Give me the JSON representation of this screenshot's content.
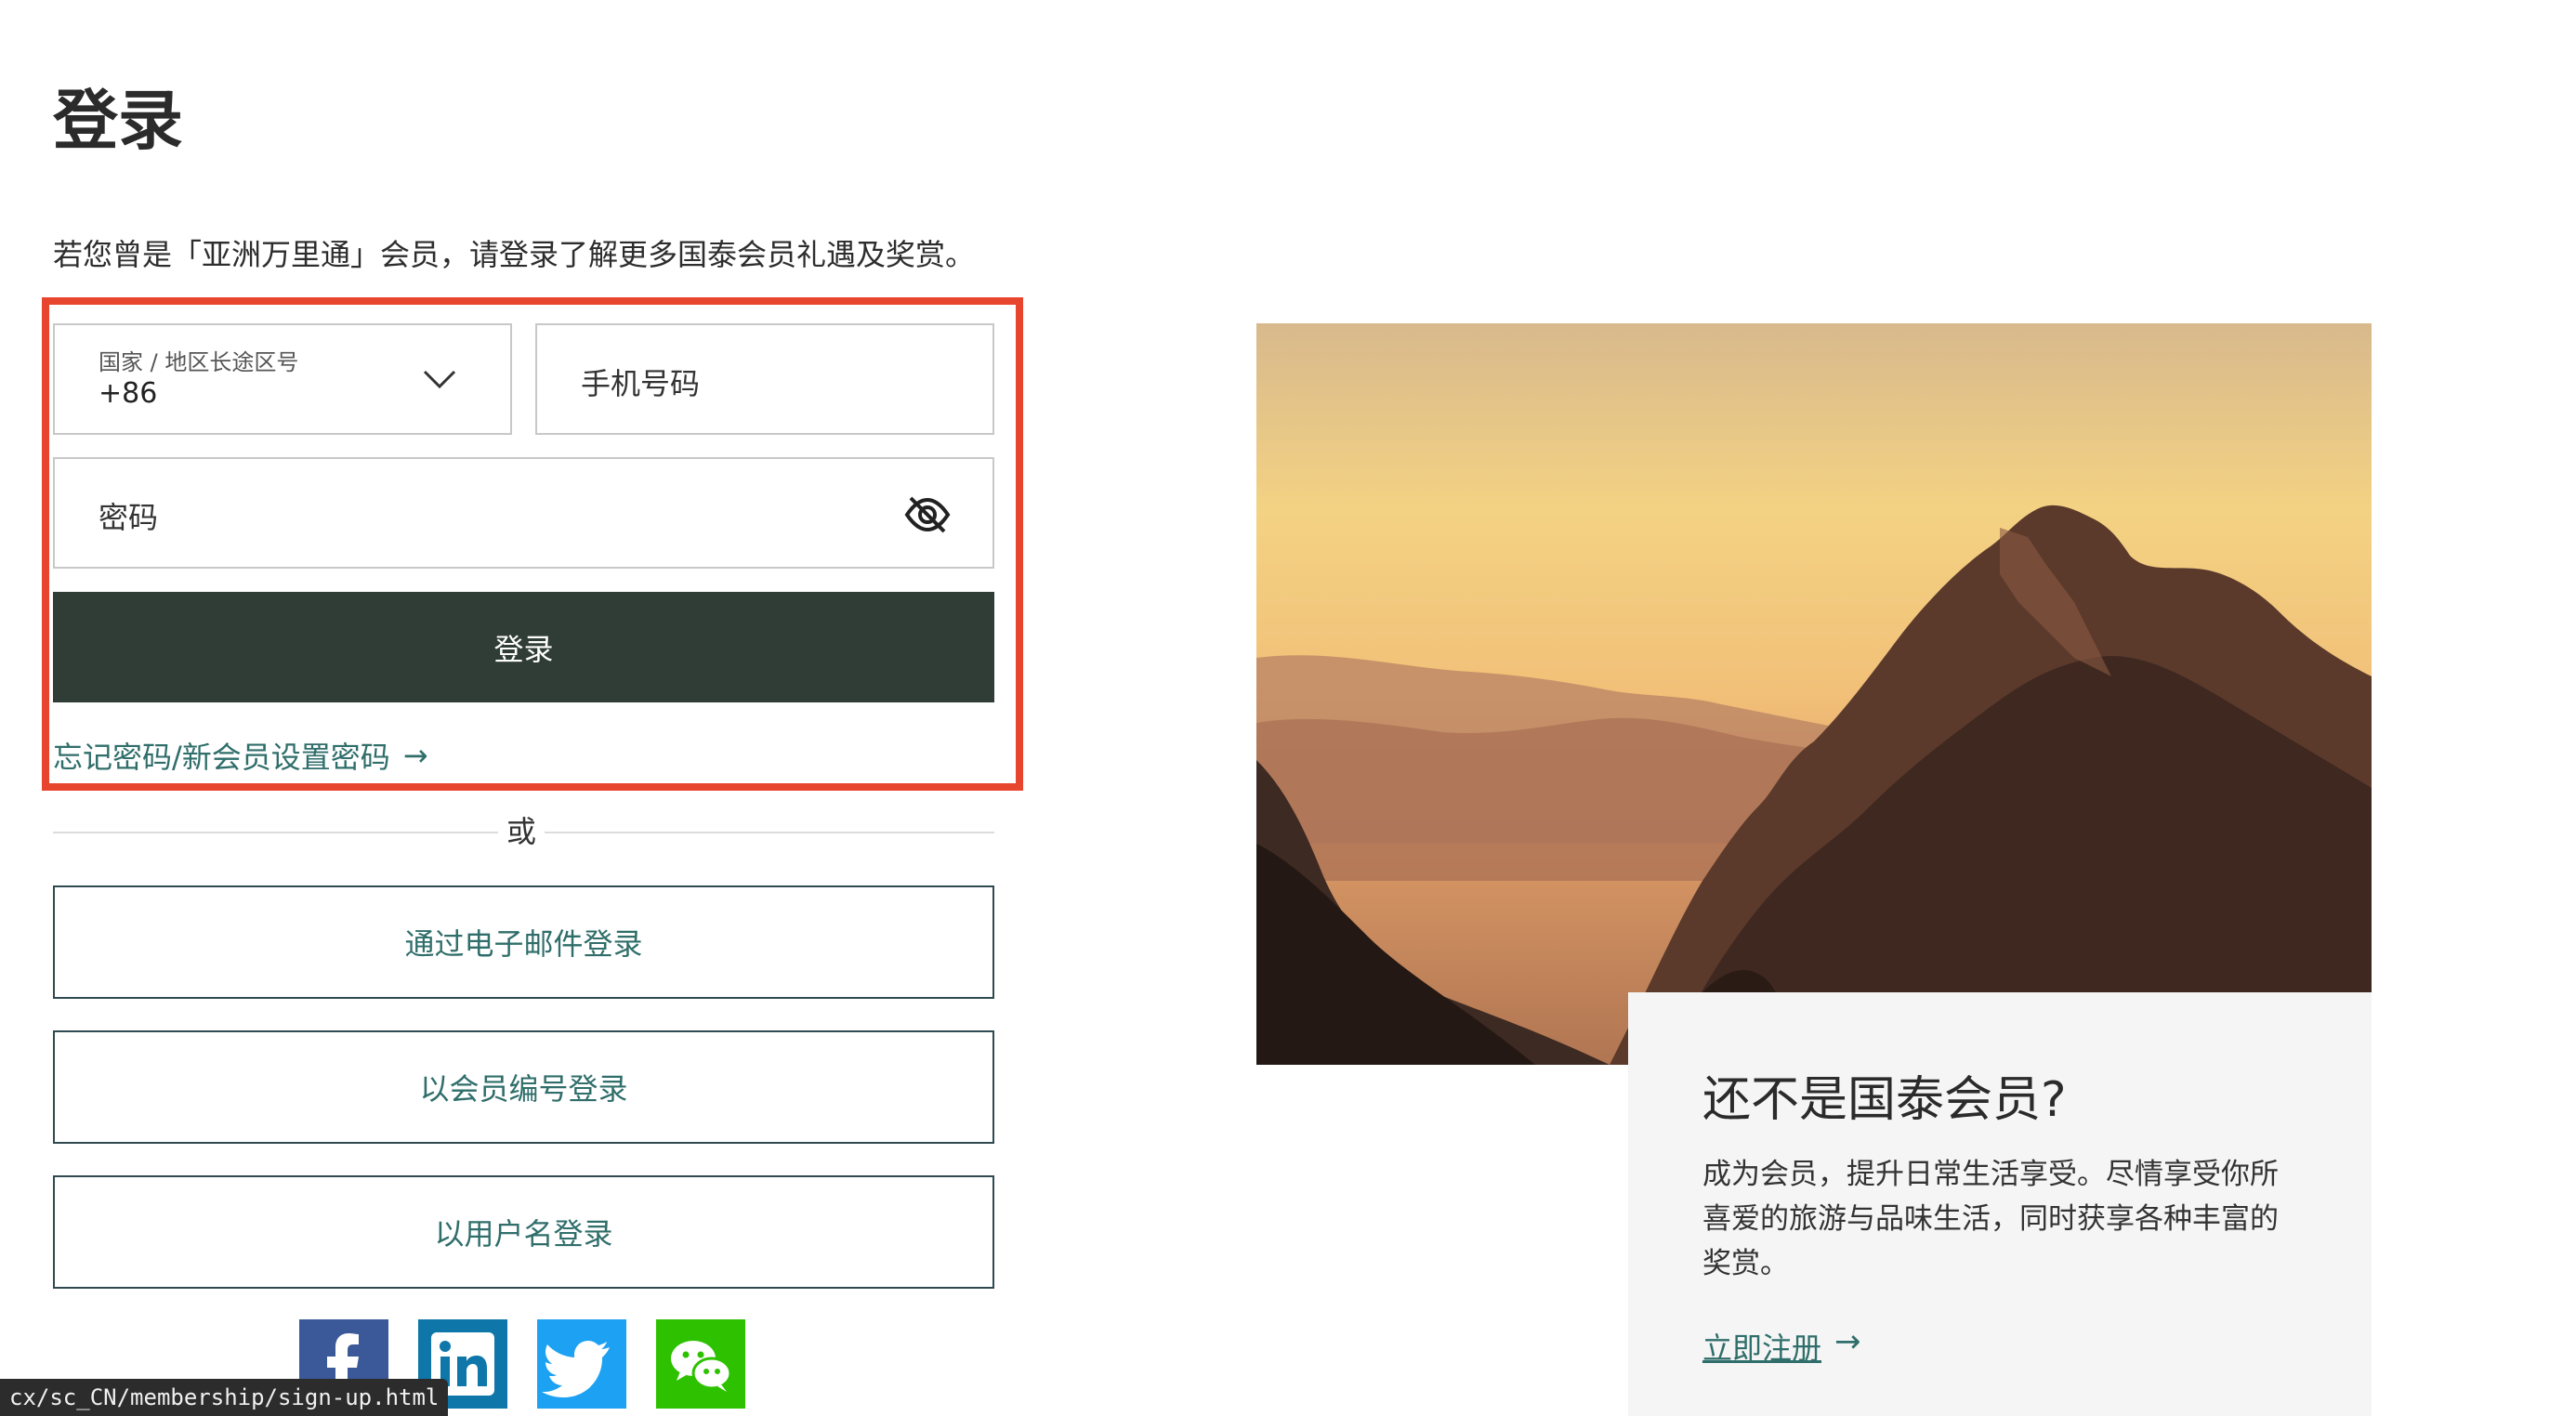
{
  "page": {
    "title": "登录",
    "intro": "若您曾是「亚洲万里通」会员，请登录了解更多国泰会员礼遇及奖赏。"
  },
  "form": {
    "country_label": "国家 / 地区长途区号",
    "country_value": "+86",
    "phone_placeholder": "手机号码",
    "password_placeholder": "密码",
    "login_button": "登录",
    "forgot_link": "忘记密码/新会员设置密码",
    "arrow": "→"
  },
  "divider": "或",
  "alt_logins": {
    "email": "通过电子邮件登录",
    "member_id": "以会员编号登录",
    "username": "以用户名登录"
  },
  "social": {
    "icons": [
      "facebook-icon",
      "linkedin-icon",
      "twitter-icon",
      "wechat-icon"
    ],
    "colors": {
      "facebook": "#3b5998",
      "linkedin": "#0e76a8",
      "twitter": "#1da1f2",
      "wechat": "#2dc100"
    }
  },
  "promo": {
    "title": "还不是国泰会员?",
    "description": "成为会员，提升日常生活享受。尽情享受你所喜爱的旅游与品味生活，同时获享各种丰富的奖赏。",
    "signup_link": "立即注册",
    "arrow": "→"
  },
  "status_bar": {
    "url": "cx/sc_CN/membership/sign-up.html"
  },
  "colors": {
    "primary_button": "#2f3d36",
    "link": "#2f6e6a",
    "highlight_border": "#e8452f"
  }
}
